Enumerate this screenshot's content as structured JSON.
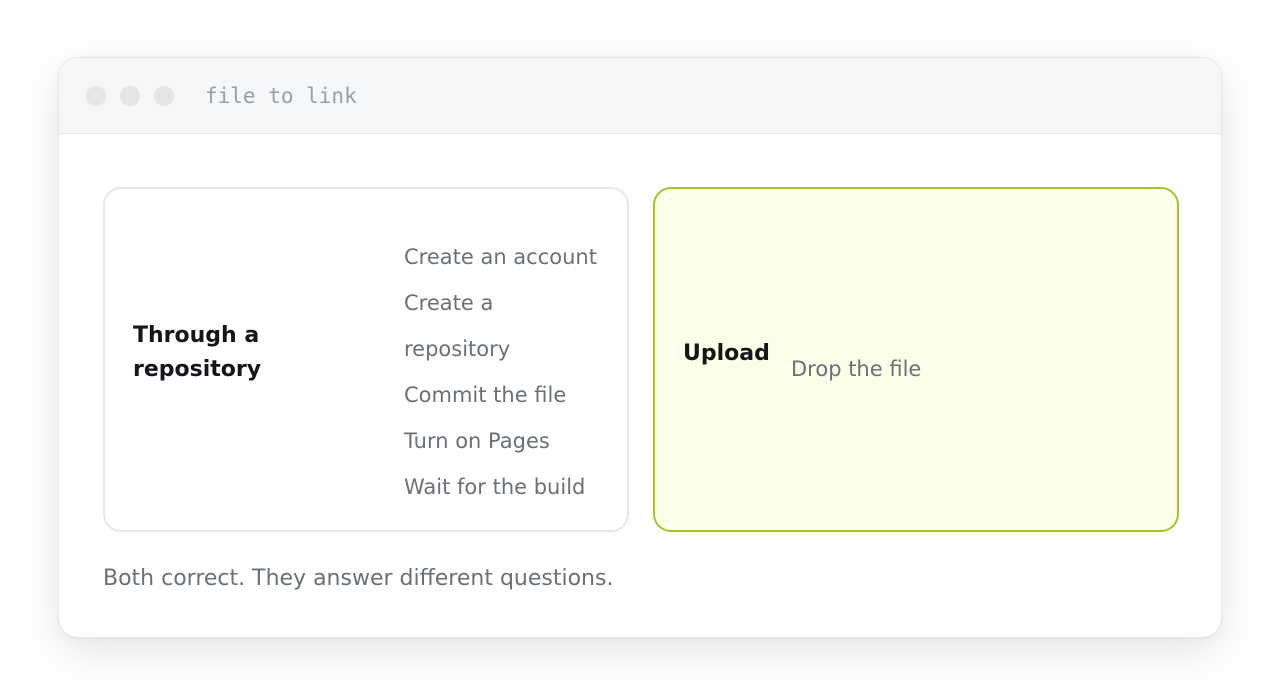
{
  "window": {
    "title": "file to link"
  },
  "options": {
    "repository": {
      "label": "Through a repository",
      "steps": [
        "Create an account",
        "Create a repository",
        "Commit the file",
        "Turn on Pages",
        "Wait for the build"
      ]
    },
    "upload": {
      "label": "Upload",
      "steps": [
        "Drop the file"
      ]
    }
  },
  "caption": "Both correct. They answer different questions.",
  "colors": {
    "upload_accent": "#a8c22b",
    "upload_background": "#fbffe8"
  }
}
